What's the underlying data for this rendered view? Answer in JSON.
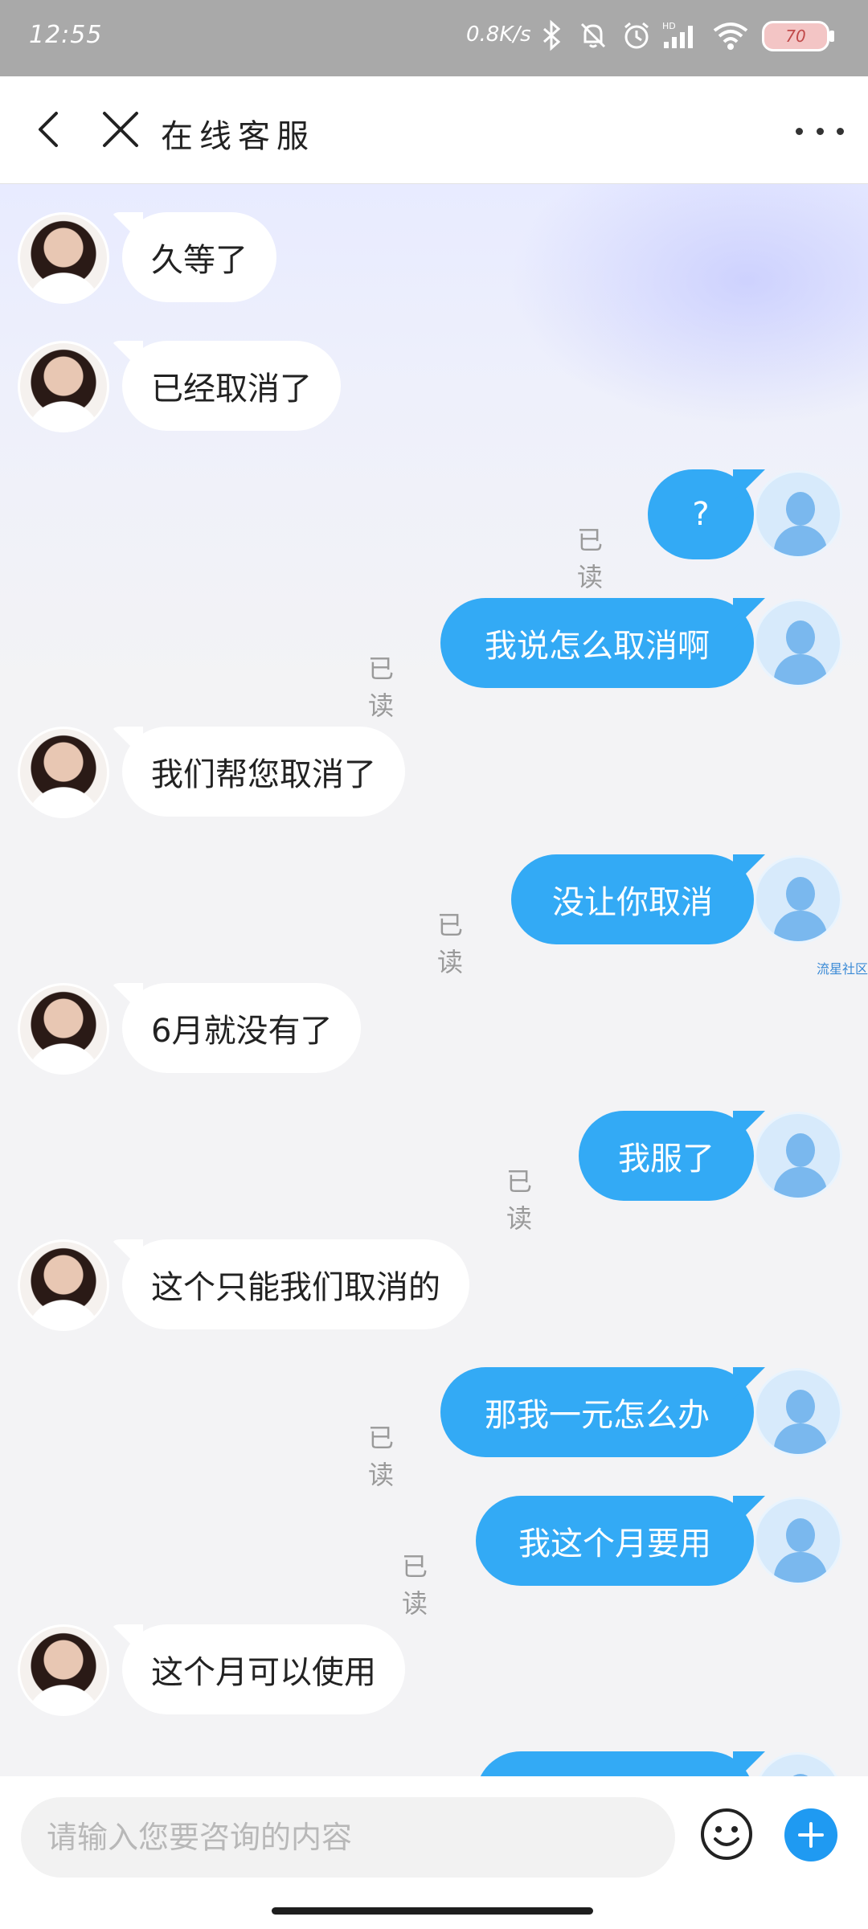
{
  "status_bar": {
    "time": "12:55",
    "net_speed": "0.8K/s",
    "battery": "70",
    "icons": [
      "bluetooth-icon",
      "mute-bell-icon",
      "alarm-icon",
      "hd-signal-icon",
      "wifi-icon",
      "battery-icon"
    ]
  },
  "header": {
    "title": "在线客服",
    "icons": [
      "back-arrow-icon",
      "close-x-icon",
      "more-dots-icon"
    ]
  },
  "colors": {
    "accent": "#33aaf5",
    "agent_bubble": "#ffffff",
    "read_text": "#9a9a9a"
  },
  "read_label": "已读",
  "watermark": "流星社区",
  "messages": [
    {
      "from": "agent",
      "text": "久等了"
    },
    {
      "from": "agent",
      "text": "已经取消了"
    },
    {
      "from": "user",
      "text": "?",
      "status": "已读"
    },
    {
      "from": "user",
      "text": "我说怎么取消啊",
      "status": "已读"
    },
    {
      "from": "agent",
      "text": "我们帮您取消了"
    },
    {
      "from": "user",
      "text": "没让你取消",
      "status": "已读"
    },
    {
      "from": "agent",
      "text": "6月就没有了"
    },
    {
      "from": "user",
      "text": "我服了",
      "status": "已读"
    },
    {
      "from": "agent",
      "text": "这个只能我们取消的"
    },
    {
      "from": "user",
      "text": "那我一元怎么办",
      "status": "已读"
    },
    {
      "from": "user",
      "text": "我这个月要用",
      "status": "已读"
    },
    {
      "from": "agent",
      "text": "这个月可以使用"
    }
  ],
  "input_bar": {
    "placeholder": "请输入您要咨询的内容",
    "icons": [
      "emoji-icon",
      "plus-icon"
    ]
  }
}
